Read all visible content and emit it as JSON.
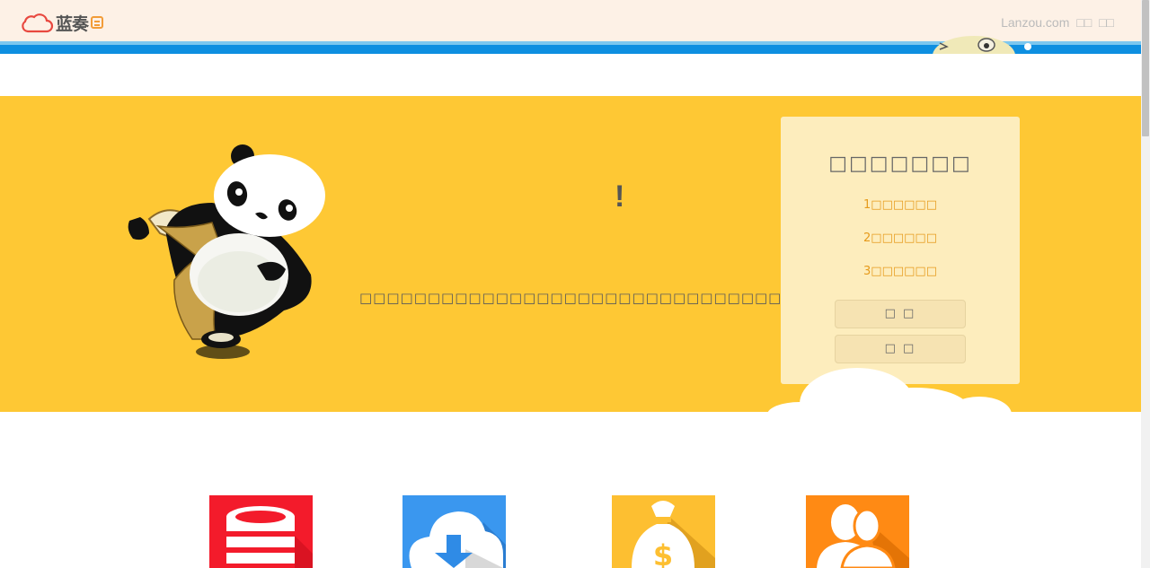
{
  "header": {
    "logo_text": "蓝奏",
    "right_site": "Lanzou.com",
    "right_link1": "□□",
    "right_link2": "□□"
  },
  "banner": {
    "exclaim": "!",
    "tagline": "□□□□□□□□□□□□□□□□□□□□□□□□□□□□□□□□□",
    "card": {
      "title": "□□□□□□□",
      "items": [
        "1□□□□□□",
        "2□□□□□□",
        "3□□□□□□"
      ],
      "button1": "□ □",
      "button2": "□ □"
    }
  },
  "features": [
    {
      "icon": "database-icon",
      "color": "#f31b2b"
    },
    {
      "icon": "cloud-download-icon",
      "color": "#3a97ef"
    },
    {
      "icon": "money-bag-icon",
      "color": "#fdbf31"
    },
    {
      "icon": "users-icon",
      "color": "#ff8a14"
    }
  ],
  "colors": {
    "banner_bg": "#fec834",
    "header_bg": "#fdf1e6",
    "blue_bar": "#0e8fe0",
    "card_bg": "#fdedbd",
    "card_item": "#e69a1b"
  }
}
